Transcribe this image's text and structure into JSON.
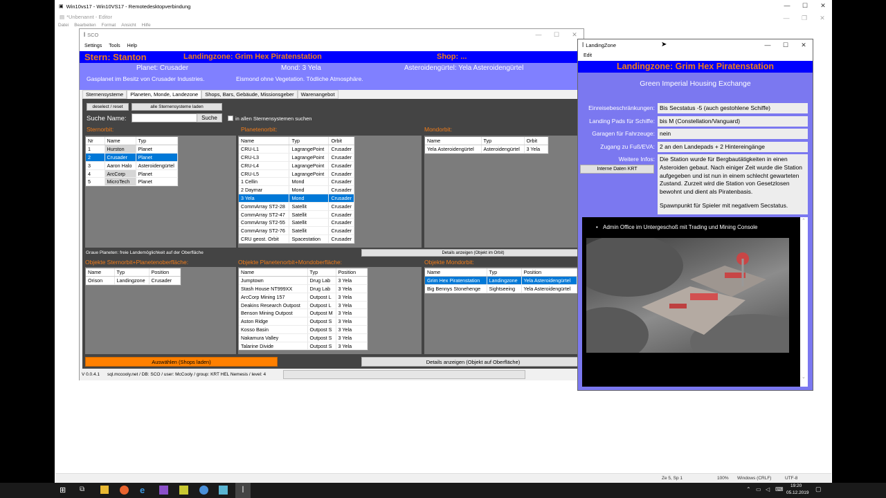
{
  "rdp": {
    "title": "Win10vs17 - Win10VS17 - Remotedesktopverbindung"
  },
  "editor": {
    "title": "*Unbenannt - Editor",
    "menu": [
      "Datei",
      "Bearbeiten",
      "Format",
      "Ansicht",
      "Hilfe"
    ],
    "status": {
      "pos": "Ze 5, Sp 1",
      "zoom": "100%",
      "eol": "Windows (CRLF)",
      "enc": "UTF-8"
    }
  },
  "sco": {
    "title": "SCO",
    "menu": [
      "Settings",
      "Tools",
      "Help"
    ],
    "header": {
      "star": "Stern:  Stanton",
      "landingzone": "Landingzone:  Grim Hex Piratenstation",
      "shop": "Shop: ..."
    },
    "info": {
      "planet": "Planet: Crusader",
      "moon": "Mond: 3 Yela",
      "belt": "Asteroidengürtel:  Yela Asteroidengürtel",
      "planet_desc": "Gasplanet im Besitz von Crusader Industries.",
      "moon_desc": "Eismond ohne Vegetation. Tödliche Atmosphäre."
    },
    "tabs": [
      "Sternensysteme",
      "Planeten, Monde, Landezone",
      "Shops, Bars, Gebäude, Missionsgeber",
      "Warenangebot"
    ],
    "active_tab": 1,
    "deselect_label": "deselect / reset",
    "load_all_label": "alle Sternensysteme laden",
    "search_label": "Suche Name:",
    "search_value": "",
    "search_button": "Suche",
    "all_systems_label": "in allen Sternensystemen suchen",
    "sections": {
      "sternorbit": "Sternorbit:",
      "planetenorbit": "Planetenorbit:",
      "mondorbit": "Mondorbit:",
      "obj_stern": "Objekte Sternorbit+Planetenoberfläche:",
      "obj_planet": "Objekte Planetenorbit+Mondoberfläche:",
      "obj_mond": "Objekte Mondorbit:"
    },
    "note": "Graue Planeten: freie Landemöglichkeit  auf der Oberfläche",
    "details_orbit": "Details anzeigen (Objekt im Orbit)",
    "select_shops": "Auswählen (Shops laden)",
    "details_surface": "Details anzeigen (Objekt auf Oberfläche)",
    "status": {
      "version": "V 0.0.4.1",
      "conn": "sql.mccooly.net / DB: SCO / user: McCooly / group: KRT HEL Nemesis / level: 4"
    },
    "star_table": {
      "headers": [
        "Nr",
        "Name",
        "Typ"
      ],
      "rows": [
        [
          "1",
          "Hurston",
          "Planet"
        ],
        [
          "2",
          "Crusader",
          "Planet"
        ],
        [
          "3",
          "Aaron Halo",
          "Asteroidengürtel"
        ],
        [
          "4",
          "ArcCorp",
          "Planet"
        ],
        [
          "5",
          "MicroTech",
          "Planet"
        ]
      ]
    },
    "planet_table": {
      "headers": [
        "Name",
        "Typ",
        "Orbit"
      ],
      "rows": [
        [
          "CRU-L1",
          "LagrangePoint",
          "Crusader"
        ],
        [
          "CRU-L3",
          "LagrangePoint",
          "Crusader"
        ],
        [
          "CRU-L4",
          "LagrangePoint",
          "Crusader"
        ],
        [
          "CRU-L5",
          "LagrangePoint",
          "Crusader"
        ],
        [
          "1 Cellin",
          "Mond",
          "Crusader"
        ],
        [
          "2 Daymar",
          "Mond",
          "Crusader"
        ],
        [
          "3 Yela",
          "Mond",
          "Crusader"
        ],
        [
          "CommArray ST2-28",
          "Satellit",
          "Crusader"
        ],
        [
          "CommArray ST2-47",
          "Satellit",
          "Crusader"
        ],
        [
          "CommArray ST2-55",
          "Satellit",
          "Crusader"
        ],
        [
          "CommArray ST2-76",
          "Satellit",
          "Crusader"
        ],
        [
          "CRU geost. Orbit",
          "Spacestation",
          "Crusader"
        ]
      ]
    },
    "moon_table": {
      "headers": [
        "Name",
        "Typ",
        "Orbit"
      ],
      "rows": [
        [
          "Yela Asteroidengürtel",
          "Asteroidengürtel",
          "3 Yela"
        ]
      ]
    },
    "obj_star_table": {
      "headers": [
        "Name",
        "Typ",
        "Position"
      ],
      "rows": [
        [
          "Orison",
          "Landingzone",
          "Crusader"
        ]
      ]
    },
    "obj_planet_table": {
      "headers": [
        "Name",
        "Typ",
        "Position"
      ],
      "rows": [
        [
          "Jumptown",
          "Drug Lab",
          "3 Yela"
        ],
        [
          "Stash House NT999XX",
          "Drug Lab",
          "3 Yela"
        ],
        [
          "ArcCorp Mining 157",
          "Outpost L",
          "3 Yela"
        ],
        [
          "Deakins Research Outpost",
          "Outpost L",
          "3 Yela"
        ],
        [
          "Benson Mining Outpost",
          "Outpost M",
          "3 Yela"
        ],
        [
          "Aston Ridge",
          "Outpost S",
          "3 Yela"
        ],
        [
          "Kosso Basin",
          "Outpost S",
          "3 Yela"
        ],
        [
          "Nakamura Valley",
          "Outpost S",
          "3 Yela"
        ],
        [
          "Talarine Divide",
          "Outpost S",
          "3 Yela"
        ]
      ]
    },
    "obj_moon_table": {
      "headers": [
        "Name",
        "Typ",
        "Position"
      ],
      "rows": [
        [
          "Grim Hex Piratenstation",
          "Landingzone",
          "Yela Asteroidengürtel"
        ],
        [
          "Big Bennys Stonehenge",
          "Sightseeing",
          "Yela Asteroidengürtel"
        ]
      ]
    }
  },
  "lz": {
    "title": "LandingZone",
    "menu": "Edit",
    "header": "Landingzone: Grim Hex Piratenstation",
    "subtitle": "Green Imperial Housing Exchange",
    "fields": [
      {
        "label": "Einreisebeschränkungen:",
        "value": "Bis Secstatus -5 (auch gestohlene Schiffe)"
      },
      {
        "label": "Landing Pads für Schiffe:",
        "value": "bis M (Constellation/Vanguard)"
      },
      {
        "label": "Garagen  für Fahrzeuge:",
        "value": "nein"
      },
      {
        "label": "Zugang zu Fuß/EVA:",
        "value": "2 an den Landepads + 2 Hintereingänge"
      }
    ],
    "more_label": "Weitere Infos:",
    "more_text": "Die Station wurde für Bergbautätigkeiten in einen Asteroiden gebaut. Nach einiger Zeit wurde die Station aufgegeben und ist nun in einem schlecht gewarteten Zustand. Zurzeit wird die Station von Gesetzlosen bewohnt und dient als Piratenbasis.",
    "more_text2": "Spawnpunkt für Spieler mit negativem Secstatus.",
    "internal_button": "Interne Daten KRT",
    "bullet": "Admin Office im Untergeschoß mit Trading und Mining Console"
  },
  "taskbar": {
    "time": "19:20",
    "date": "05.12.2019"
  },
  "colors": {
    "blue": "#0000ff",
    "purple": "#8080ff",
    "orange": "#f07c1a",
    "select": "#0078d7",
    "lzpurple": "#7b78f0"
  }
}
